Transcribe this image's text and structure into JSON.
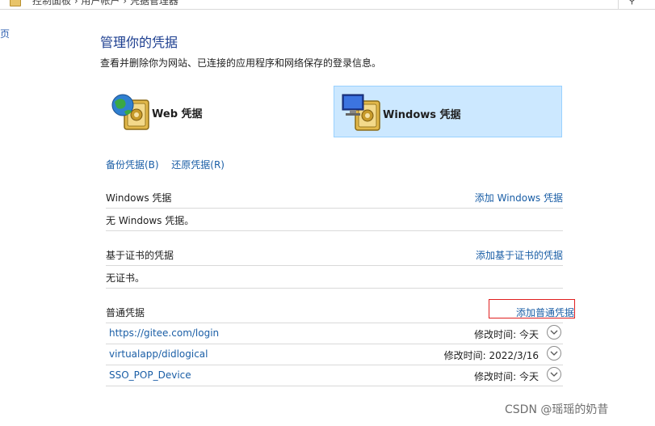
{
  "breadcrumb": "控制面板 › 用户帐户 › 凭据管理器",
  "left_edge_text": "页",
  "header": {
    "title": "管理你的凭据",
    "subtitle": "查看并删除你为网站、已连接的应用程序和网络保存的登录信息。"
  },
  "tiles": {
    "web": {
      "label": "Web 凭据"
    },
    "windows": {
      "label": "Windows 凭据",
      "selected": true
    }
  },
  "actions": {
    "backup": "备份凭据(B)",
    "restore": "还原凭据(R)"
  },
  "sections": {
    "windows": {
      "title": "Windows 凭据",
      "add": "添加 Windows 凭据",
      "empty": "无 Windows 凭据。"
    },
    "certificate": {
      "title": "基于证书的凭据",
      "add": "添加基于证书的凭据",
      "empty": "无证书。"
    },
    "generic": {
      "title": "普通凭据",
      "add": "添加普通凭据",
      "items": [
        {
          "name": "https://gitee.com/login",
          "modified": "修改时间:  今天"
        },
        {
          "name": "virtualapp/didlogical",
          "modified": "修改时间:  2022/3/16"
        },
        {
          "name": "SSO_POP_Device",
          "modified": "修改时间:  今天"
        }
      ]
    }
  },
  "watermark": "CSDN @瑶瑶的奶昔",
  "colors": {
    "link": "#1a5ea6",
    "title": "#1b3d8f",
    "selected_tile": "#cce8ff",
    "highlight_box": "#e02020"
  },
  "icons": [
    "folder-icon",
    "search-icon",
    "globe-vault-icon",
    "monitor-vault-icon",
    "chevron-down-icon"
  ]
}
